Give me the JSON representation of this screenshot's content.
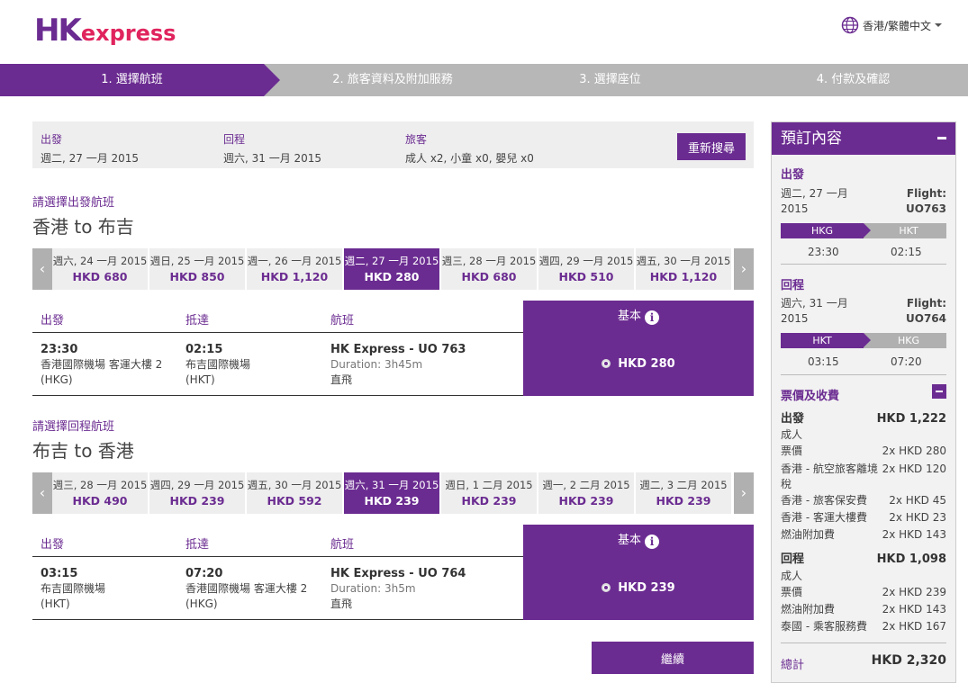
{
  "header": {
    "logo_hk": "HK",
    "logo_express": "express",
    "language": "香港/繁體中文"
  },
  "steps": [
    {
      "label": "1. 選擇航班",
      "active": true
    },
    {
      "label": "2. 旅客資料及附加服務",
      "active": false
    },
    {
      "label": "3. 選擇座位",
      "active": false
    },
    {
      "label": "4. 付款及確認",
      "active": false
    }
  ],
  "summary": {
    "depart_label": "出發",
    "depart_value": "週二, 27 一月 2015",
    "return_label": "回程",
    "return_value": "週六, 31 一月 2015",
    "pax_label": "旅客",
    "pax_value": "成人 x2, 小童 x0, 嬰兒 x0",
    "research_button": "重新搜尋"
  },
  "outbound": {
    "section_label": "請選擇出發航班",
    "route": "香港 to 布吉",
    "dates": [
      {
        "date": "週六, 24 一月 2015",
        "price": "HKD 680"
      },
      {
        "date": "週日, 25 一月 2015",
        "price": "HKD 850"
      },
      {
        "date": "週一, 26 一月 2015",
        "price": "HKD 1,120"
      },
      {
        "date": "週二, 27 一月 2015",
        "price": "HKD 280",
        "selected": true
      },
      {
        "date": "週三, 28 一月 2015",
        "price": "HKD 680"
      },
      {
        "date": "週四, 29 一月 2015",
        "price": "HKD 510"
      },
      {
        "date": "週五, 30 一月 2015",
        "price": "HKD 1,120"
      }
    ],
    "head_depart": "出發",
    "head_arrive": "抵達",
    "head_flight": "航班",
    "head_fare": "基本",
    "dep_time": "23:30",
    "dep_airport": "香港國際機場 客運大樓 2",
    "dep_code": "(HKG)",
    "arr_time": "02:15",
    "arr_airport": "布吉國際機場",
    "arr_code": "(HKT)",
    "flight_name": "HK Express - UO 763",
    "duration": "Duration: 3h45m",
    "type": "直飛",
    "fare": "HKD 280"
  },
  "inbound": {
    "section_label": "請選擇回程航班",
    "route": "布吉 to 香港",
    "dates": [
      {
        "date": "週三, 28 一月 2015",
        "price": "HKD 490"
      },
      {
        "date": "週四, 29 一月 2015",
        "price": "HKD 239"
      },
      {
        "date": "週五, 30 一月 2015",
        "price": "HKD 592"
      },
      {
        "date": "週六, 31 一月 2015",
        "price": "HKD 239",
        "selected": true
      },
      {
        "date": "週日, 1 二月 2015",
        "price": "HKD 239"
      },
      {
        "date": "週一, 2 二月 2015",
        "price": "HKD 239"
      },
      {
        "date": "週二, 3 二月 2015",
        "price": "HKD 239"
      }
    ],
    "head_depart": "出發",
    "head_arrive": "抵達",
    "head_flight": "航班",
    "head_fare": "基本",
    "dep_time": "03:15",
    "dep_airport": "布吉國際機場",
    "dep_code": "(HKT)",
    "arr_time": "07:20",
    "arr_airport": "香港國際機場 客運大樓 2",
    "arr_code": "(HKG)",
    "flight_name": "HK Express - UO 764",
    "duration": "Duration: 3h5m",
    "type": "直飛",
    "fare": "HKD 239"
  },
  "continue_button": "繼續",
  "panel": {
    "title": "預訂內容",
    "out_label": "出發",
    "out_date": "週二, 27 一月",
    "out_year": "2015",
    "out_flight_label": "Flight:",
    "out_flight": "UO763",
    "out_from": "HKG",
    "out_to": "HKT",
    "out_dep": "23:30",
    "out_arr": "02:15",
    "ret_label": "回程",
    "ret_date": "週六, 31 一月",
    "ret_year": "2015",
    "ret_flight_label": "Flight:",
    "ret_flight": "UO764",
    "ret_from": "HKT",
    "ret_to": "HKG",
    "ret_dep": "03:15",
    "ret_arr": "07:20",
    "fares_label": "票價及收費",
    "out_total_label": "出發",
    "out_total": "HKD 1,222",
    "out_adult": "成人",
    "out_items": [
      {
        "name": "票價",
        "amount": "2x HKD 280"
      },
      {
        "name": "香港 - 航空旅客離境",
        "amount": "2x HKD 120"
      },
      {
        "name": "稅",
        "amount": ""
      },
      {
        "name": "香港 - 旅客保安費",
        "amount": "2x HKD 45"
      },
      {
        "name": "香港 - 客運大樓費",
        "amount": "2x HKD 23"
      },
      {
        "name": "燃油附加費",
        "amount": "2x HKD 143"
      }
    ],
    "ret_total_label": "回程",
    "ret_total": "HKD 1,098",
    "ret_adult": "成人",
    "ret_items": [
      {
        "name": "票價",
        "amount": "2x HKD 239"
      },
      {
        "name": "燃油附加費",
        "amount": "2x HKD 143"
      },
      {
        "name": "泰國 - 乘客服務費",
        "amount": "2x HKD 167"
      }
    ],
    "grand_label": "總計",
    "grand_total": "HKD 2,320"
  },
  "colors": {
    "brand_purple": "#6b2c91",
    "logo_red": "#e0245e",
    "step_grey": "#b7b7b7"
  }
}
